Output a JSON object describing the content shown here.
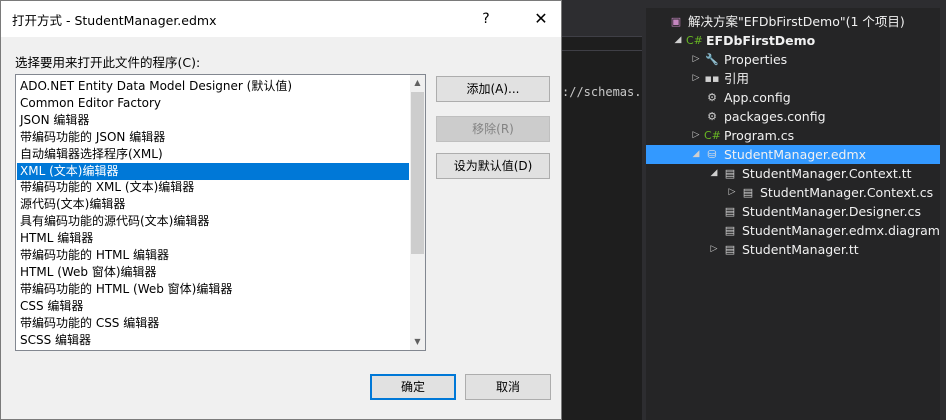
{
  "dialog": {
    "title": "打开方式 - StudentManager.edmx",
    "help_icon": "?",
    "close_icon": "✕",
    "prompt": "选择要用来打开此文件的程序(C):",
    "programs": [
      "ADO.NET Entity Data Model Designer (默认值)",
      "Common Editor Factory",
      "JSON 编辑器",
      "带编码功能的 JSON 编辑器",
      "自动编辑器选择程序(XML)",
      "XML (文本)编辑器",
      "带编码功能的 XML (文本)编辑器",
      "源代码(文本)编辑器",
      "具有编码功能的源代码(文本)编辑器",
      "HTML 编辑器",
      "带编码功能的 HTML 编辑器",
      "HTML (Web 窗体)编辑器",
      "带编码功能的 HTML (Web 窗体)编辑器",
      "CSS 编辑器",
      "带编码功能的 CSS 编辑器",
      "SCSS 编辑器"
    ],
    "selected_program": "XML (文本)编辑器",
    "buttons": {
      "add": "添加(A)...",
      "remove": "移除(R)",
      "set_default": "设为默认值(D)",
      "ok": "确定",
      "cancel": "取消"
    }
  },
  "editor": {
    "code_fragment": "://schemas.m"
  },
  "solution_explorer": {
    "items": [
      {
        "label": "解决方案\"EFDbFirstDemo\"(1 个项目)",
        "icon": "solution-icon",
        "indent": 0,
        "expander": "",
        "bold": false
      },
      {
        "label": "EFDbFirstDemo",
        "icon": "csharp-project-icon",
        "indent": 1,
        "expander": "◢",
        "bold": true
      },
      {
        "label": "Properties",
        "icon": "wrench-icon",
        "indent": 2,
        "expander": "▷",
        "bold": false
      },
      {
        "label": "引用",
        "icon": "references-icon",
        "indent": 2,
        "expander": "▷",
        "bold": false
      },
      {
        "label": "App.config",
        "icon": "config-file-icon",
        "indent": 2,
        "expander": "",
        "bold": false
      },
      {
        "label": "packages.config",
        "icon": "config-file-icon",
        "indent": 2,
        "expander": "",
        "bold": false
      },
      {
        "label": "Program.cs",
        "icon": "csharp-file-icon",
        "indent": 2,
        "expander": "▷",
        "bold": false
      },
      {
        "label": "StudentManager.edmx",
        "icon": "edmx-file-icon",
        "indent": 2,
        "expander": "◢",
        "bold": false,
        "selected": true
      },
      {
        "label": "StudentManager.Context.tt",
        "icon": "tt-file-icon",
        "indent": 3,
        "expander": "◢",
        "bold": false
      },
      {
        "label": "StudentManager.Context.cs",
        "icon": "cs-file-icon",
        "indent": 4,
        "expander": "▷",
        "bold": false
      },
      {
        "label": "StudentManager.Designer.cs",
        "icon": "cs-file-icon",
        "indent": 3,
        "expander": "",
        "bold": false
      },
      {
        "label": "StudentManager.edmx.diagram",
        "icon": "diagram-file-icon",
        "indent": 3,
        "expander": "",
        "bold": false
      },
      {
        "label": "StudentManager.tt",
        "icon": "tt-file-icon",
        "indent": 3,
        "expander": "▷",
        "bold": false
      }
    ]
  },
  "colors": {
    "selection_blue": "#0078d7",
    "explorer_selection": "#3399ff",
    "dark_bg": "#1e1e1e"
  }
}
